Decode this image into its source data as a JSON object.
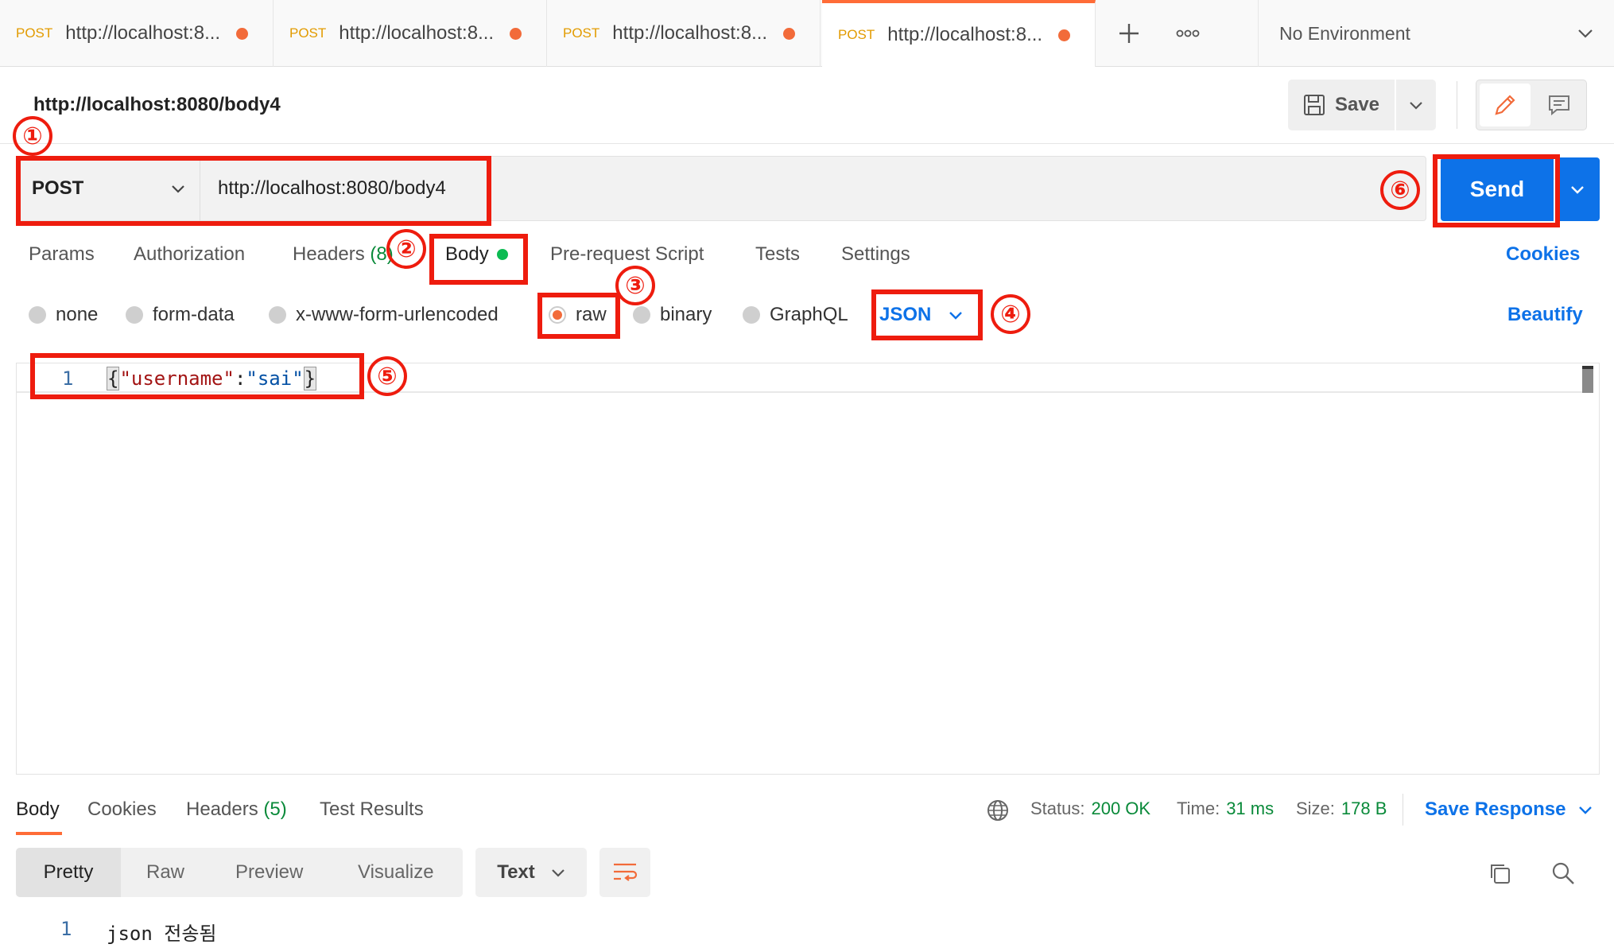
{
  "tabs": [
    {
      "method": "POST",
      "url": "http://localhost:8..."
    },
    {
      "method": "POST",
      "url": "http://localhost:8..."
    },
    {
      "method": "POST",
      "url": "http://localhost:8..."
    },
    {
      "method": "POST",
      "url": "http://localhost:8..."
    }
  ],
  "environment": "No Environment",
  "request": {
    "title": "http://localhost:8080/body4",
    "method": "POST",
    "url": "http://localhost:8080/body4",
    "save_label": "Save",
    "send_label": "Send"
  },
  "request_tabs": {
    "params": "Params",
    "authorization": "Authorization",
    "headers": "Headers",
    "headers_count": "(8)",
    "body": "Body",
    "prerequest": "Pre-request Script",
    "tests": "Tests",
    "settings": "Settings",
    "cookies": "Cookies"
  },
  "body_types": {
    "none": "none",
    "form_data": "form-data",
    "urlencoded": "x-www-form-urlencoded",
    "raw": "raw",
    "binary": "binary",
    "graphql": "GraphQL",
    "format": "JSON",
    "beautify": "Beautify",
    "selected": "raw"
  },
  "editor": {
    "line_number": "1",
    "open_brace": "{",
    "key": "\"username\"",
    "colon": ":",
    "value": "\"sai\"",
    "close_brace": "}"
  },
  "annotations": {
    "n1": "①",
    "n2": "②",
    "n3": "③",
    "n4": "④",
    "n5": "⑤",
    "n6": "⑥"
  },
  "response": {
    "tabs": {
      "body": "Body",
      "cookies": "Cookies",
      "headers": "Headers",
      "headers_count": "(5)",
      "test_results": "Test Results"
    },
    "status_label": "Status:",
    "status_value": "200 OK",
    "time_label": "Time:",
    "time_value": "31 ms",
    "size_label": "Size:",
    "size_value": "178 B",
    "save_response": "Save Response",
    "views": {
      "pretty": "Pretty",
      "raw": "Raw",
      "preview": "Preview",
      "visualize": "Visualize"
    },
    "format": "Text",
    "line_number": "1",
    "content": "json 전송됨"
  },
  "colors": {
    "accent": "#ff6c37",
    "send": "#0d72e8",
    "annotation": "#ee1c0e",
    "status_ok": "#0a8a3a"
  }
}
